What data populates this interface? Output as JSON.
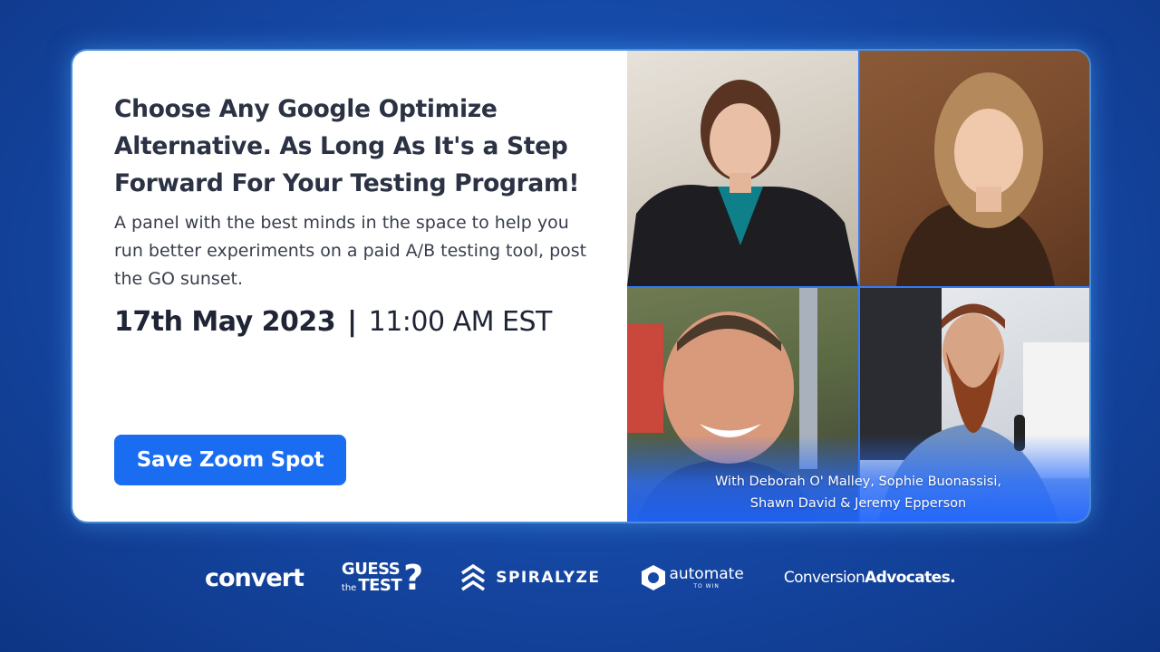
{
  "event": {
    "headline": "Choose Any Google Optimize Alternative. As Long As It's a Step Forward For Your Testing Program!",
    "description": "A panel with the best minds in the space to help you run better experiments on a paid A/B testing tool, post the GO sunset.",
    "date": "17th May 2023",
    "separator": "|",
    "time": "11:00 AM EST",
    "cta_label": "Save Zoom Spot"
  },
  "panel": {
    "caption_line1": "With Deborah O' Malley, Sophie Buonassisi,",
    "caption_line2": "Shawn David & Jeremy Epperson"
  },
  "sponsors": {
    "convert": "convert",
    "guess_the_test_line1": "GUESS",
    "guess_the_test_the": "the",
    "guess_the_test_line2": "TEST",
    "spiralyze": "SPIRALYZE",
    "automate": "automate",
    "automate_sub": "TO WIN",
    "conversion_advocates_regular": "Conversion",
    "conversion_advocates_bold": "Advocates."
  },
  "colors": {
    "background": "#164aa8",
    "cta": "#1a6cf0",
    "headline": "#2b3243"
  }
}
